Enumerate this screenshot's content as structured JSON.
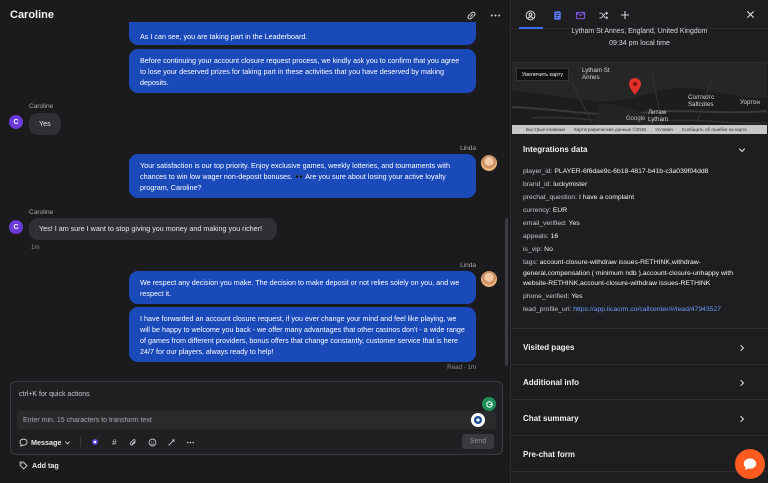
{
  "chat": {
    "title": "Caroline",
    "messages": [
      {
        "type": "agent",
        "text": "As I can see, you are taking part in the Leaderboard."
      },
      {
        "type": "agent",
        "text": "Before continuing your account closure request process, we kindly ask you to confirm that you agree to lose your deserved prizes for taking part in these activities that you have deserved by making deposits."
      },
      {
        "type": "customer",
        "sender": "Caroline",
        "avatar": "C",
        "text": "Yes"
      },
      {
        "type": "agent",
        "sender": "Linda",
        "text": "Your satisfaction is our top priority. Enjoy exclusive games, weekly lotteries, and tournaments with chances to win low wager non-deposit bonuses. 🕶️ Are you sure about losing your active loyalty program, Caroline?"
      },
      {
        "type": "customer",
        "sender": "Caroline",
        "avatar": "C",
        "text": "Yes! I am sure I want to stop giving you money and making you richer!",
        "time": "1m"
      },
      {
        "type": "agent",
        "sender": "Linda",
        "text": "We respect any decision you make. The decision to make deposit or not relies solely on you, and we respect it."
      },
      {
        "type": "agent",
        "text": "I have forwarded an account closure request, if you ever change your mind and feel like playing, we will be happy to welcome you back - we offer many advantages that other casinos don't - a wide range of games from different providers, bonus offers that change constantly, customer service that is here 24/7 for our players, always ready to help!",
        "status": "Read · 1m"
      }
    ]
  },
  "composer": {
    "hint": "ctrl+K for quick actions",
    "placeholder": "Enter min. 15 characters to transform text",
    "message_type": "Message",
    "send_label": "Send",
    "add_tag_label": "Add tag"
  },
  "details": {
    "location": "Lytham St Annes, England, United Kingdom",
    "local_time": "09:34 pm local time",
    "map": {
      "enlarge_label": "Увеличить карту",
      "labels": [
        "Lytham St Annes",
        "Солткотс Saltcotes",
        "Литам Lytham",
        "Уортон"
      ],
      "google": "Google",
      "footer": [
        "Быстрые клавиши",
        "Картографические данные ©2025",
        "Условия",
        "Сообщить об ошибке на карте"
      ]
    },
    "integrations_title": "Integrations data",
    "fields": [
      {
        "key": "player_id:",
        "value": "PLAYER-6f6dae9c-6b18-4817-b41b-c3a039f04dd8"
      },
      {
        "key": "brand_id:",
        "value": "luckymister"
      },
      {
        "key": "prechat_question:",
        "value": "I have a complaint"
      },
      {
        "key": "currency:",
        "value": "EUR"
      },
      {
        "key": "email_verified:",
        "value": "Yes"
      },
      {
        "key": "appeals:",
        "value": "16"
      },
      {
        "key": "is_vip:",
        "value": "No"
      },
      {
        "key": "tags:",
        "value": "account-closure-withdraw issues-RETHINK,withdraw-general,compensation ( minimum ndb ),account-closure-unhappy with website-RETHINK,account-closure-withdraw issues-RETHINK"
      },
      {
        "key": "phone_verified:",
        "value": "Yes"
      },
      {
        "key": "lead_profile_url:",
        "value": "https://app.licacrm.co/callcenter/#/lead/47943527"
      }
    ],
    "sections": [
      "Visited pages",
      "Additional info",
      "Chat summary",
      "Pre-chat form"
    ]
  },
  "colors": {
    "agent_bubble": "#1a49b9",
    "customer_bubble": "#303034",
    "accent": "#3d6ef2",
    "fab": "#ff5a1f"
  }
}
